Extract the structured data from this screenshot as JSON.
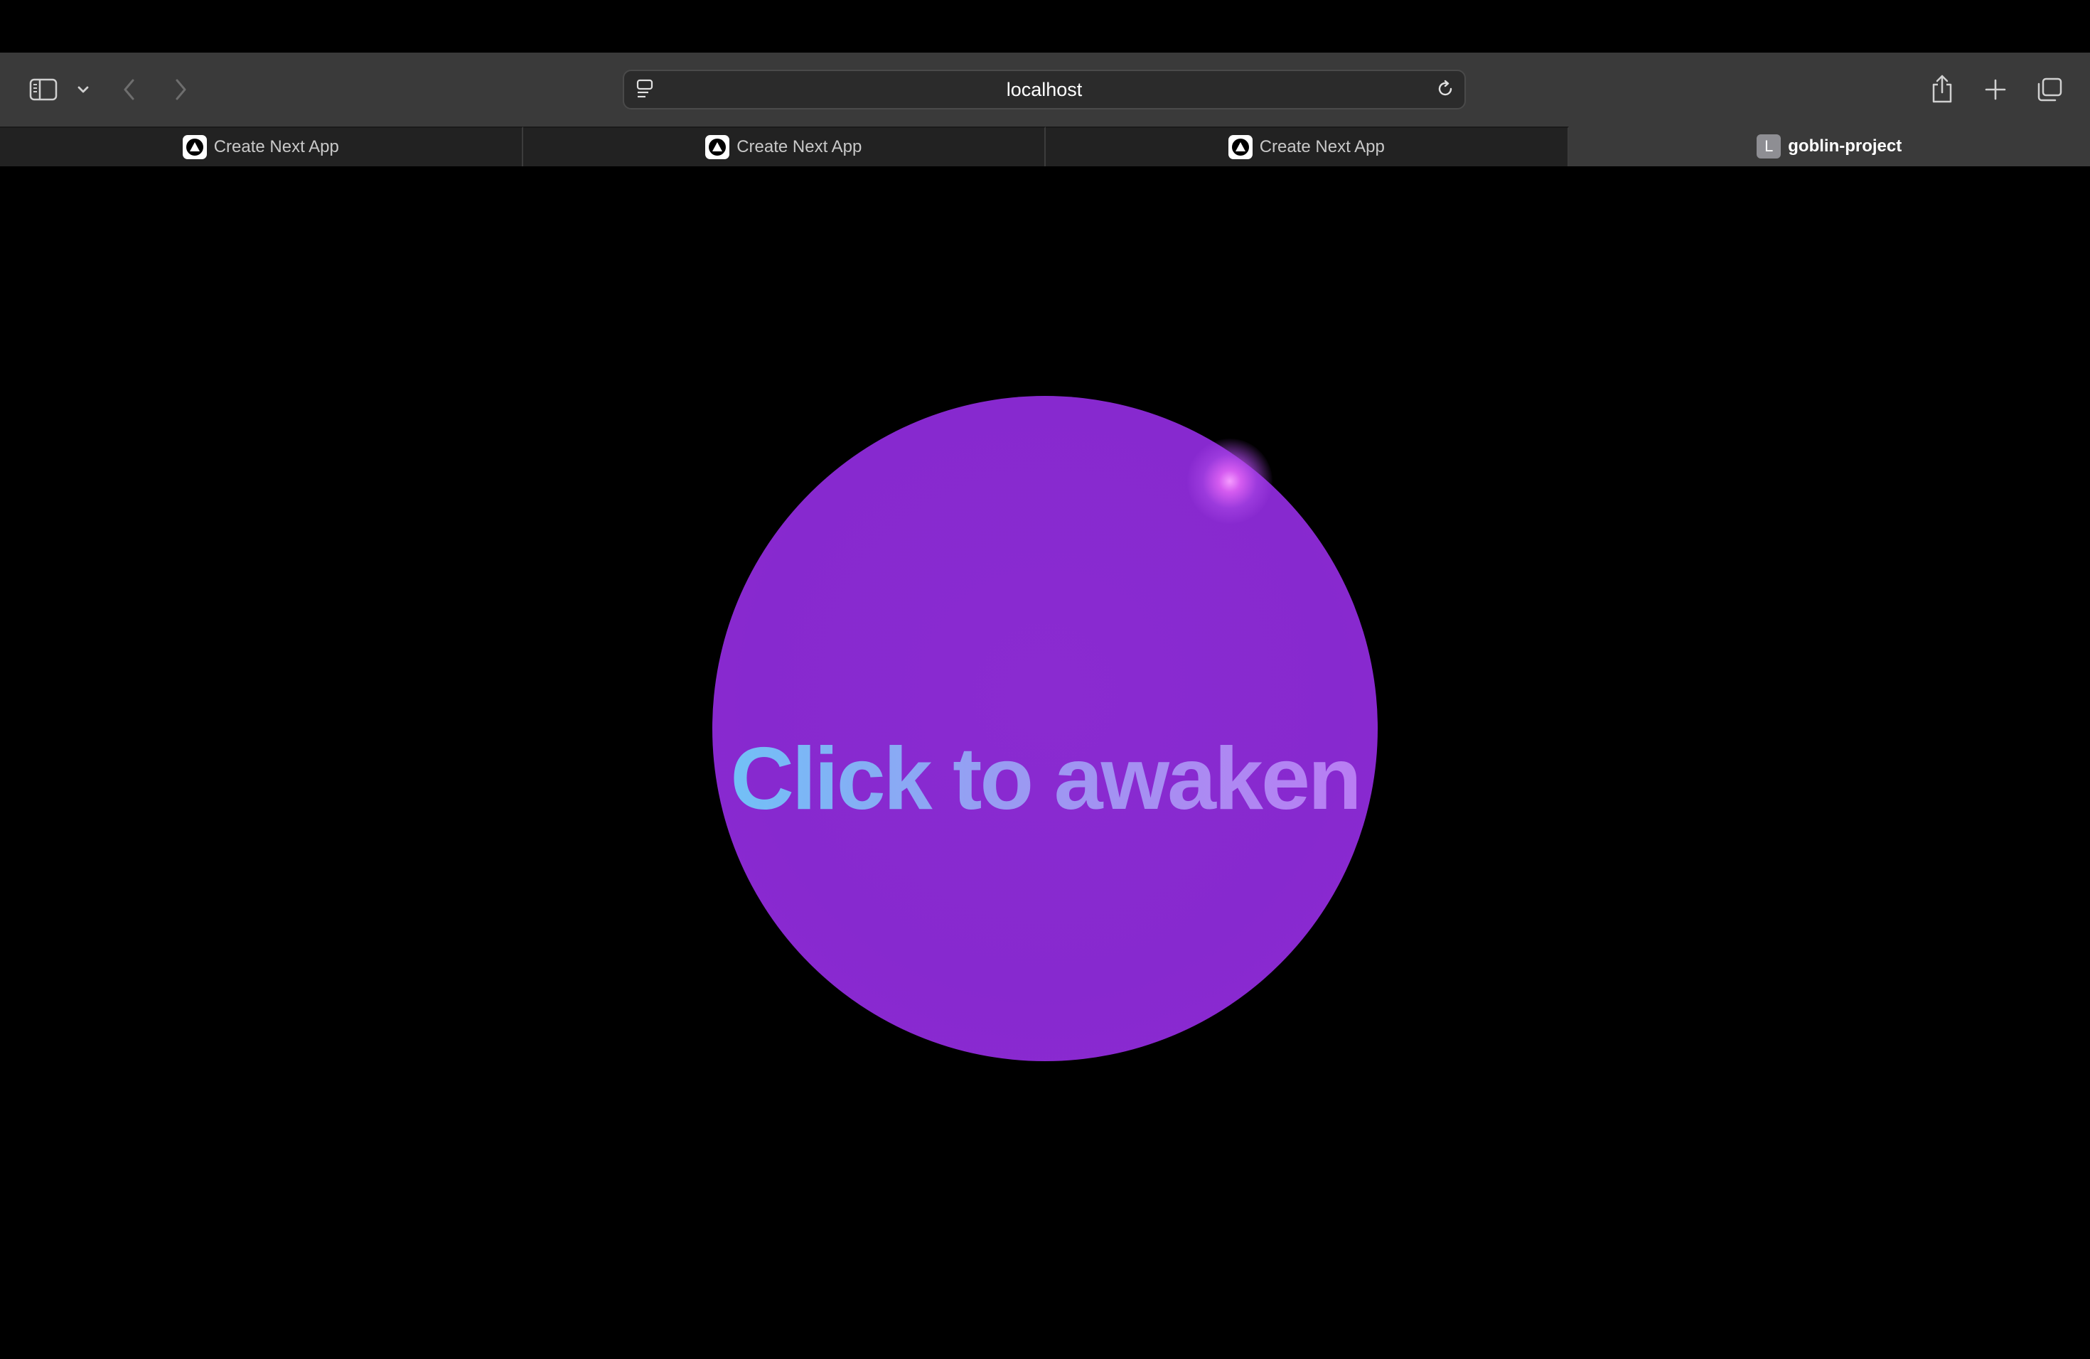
{
  "browser": {
    "url": "localhost",
    "tabs": [
      {
        "label": "Create Next App",
        "favicon": "nextjs-logo",
        "active": false
      },
      {
        "label": "Create Next App",
        "favicon": "nextjs-logo",
        "active": false
      },
      {
        "label": "Create Next App",
        "favicon": "nextjs-logo",
        "active": false
      },
      {
        "label": "goblin-project",
        "favicon": "letter-l",
        "favicon_letter": "L",
        "active": true
      }
    ]
  },
  "main": {
    "orb_label": "Click to awaken",
    "orb_color": "#8a2bd0",
    "label_gradient": [
      "#6fc3f7",
      "#bb7cf3"
    ]
  },
  "icons": {
    "sidebar": "sidebar-icon",
    "sidebar_menu": "chevron-down-icon",
    "back": "chevron-left-icon",
    "forward": "chevron-right-icon",
    "page_menu": "page-menu-icon",
    "reload": "reload-icon",
    "share": "share-icon",
    "new_tab": "plus-icon",
    "tab_overview": "tab-overview-icon"
  }
}
